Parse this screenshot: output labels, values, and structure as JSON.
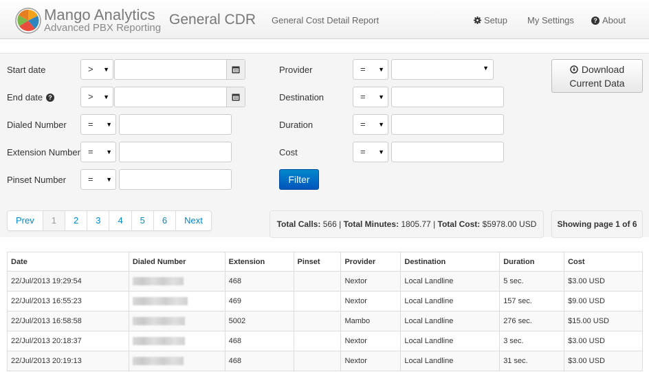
{
  "header": {
    "brand_name": "Mango Analytics",
    "brand_subtitle": "Advanced PBX Reporting",
    "title": "General CDR",
    "subtitle": "General Cost Detail Report",
    "links": {
      "setup": "Setup",
      "my_settings": "My Settings",
      "about": "About"
    }
  },
  "filters": {
    "start_date": {
      "label": "Start date",
      "operator": ">",
      "value": ""
    },
    "end_date": {
      "label": "End date",
      "operator": ">",
      "value": ""
    },
    "dialed_number": {
      "label": "Dialed Number",
      "operator": "=",
      "value": ""
    },
    "extension_number": {
      "label": "Extension Number",
      "operator": "=",
      "value": ""
    },
    "pinset_number": {
      "label": "Pinset Number",
      "operator": "=",
      "value": ""
    },
    "provider": {
      "label": "Provider",
      "operator": "=",
      "value": ""
    },
    "destination": {
      "label": "Destination",
      "operator": "=",
      "value": ""
    },
    "duration": {
      "label": "Duration",
      "operator": "=",
      "value": ""
    },
    "cost": {
      "label": "Cost",
      "operator": "=",
      "value": ""
    },
    "filter_button": "Filter",
    "download_line1": "Download",
    "download_line2": "Current Data"
  },
  "pagination": {
    "prev": "Prev",
    "pages": [
      "1",
      "2",
      "3",
      "4",
      "5",
      "6"
    ],
    "active_page": "1",
    "next": "Next"
  },
  "totals": {
    "calls_label": "Total Calls:",
    "calls": "566",
    "minutes_label": "Total Minutes:",
    "minutes": "1805.77",
    "cost_label": "Total Cost:",
    "cost": "$5978.00 USD",
    "showing": "Showing page 1 of 6"
  },
  "table": {
    "headers": [
      "Date",
      "Dialed Number",
      "Extension",
      "Pinset",
      "Provider",
      "Destination",
      "Duration",
      "Cost"
    ],
    "rows": [
      {
        "date": "22/Jul/2013 19:29:54",
        "dialed": "",
        "extension": "468",
        "pinset": "",
        "provider": "Nextor",
        "destination": "Local Landline",
        "duration": "5 sec.",
        "cost": "$3.00 USD"
      },
      {
        "date": "22/Jul/2013 16:55:23",
        "dialed": "",
        "extension": "469",
        "pinset": "",
        "provider": "Nextor",
        "destination": "Local Landline",
        "duration": "157 sec.",
        "cost": "$9.00 USD"
      },
      {
        "date": "22/Jul/2013 16:58:58",
        "dialed": "",
        "extension": "5002",
        "pinset": "",
        "provider": "Mambo",
        "destination": "Local Landline",
        "duration": "276 sec.",
        "cost": "$15.00 USD"
      },
      {
        "date": "22/Jul/2013 20:18:37",
        "dialed": "",
        "extension": "468",
        "pinset": "",
        "provider": "Nextor",
        "destination": "Local Landline",
        "duration": "3 sec.",
        "cost": "$3.00 USD"
      },
      {
        "date": "22/Jul/2013 20:19:13",
        "dialed": "",
        "extension": "468",
        "pinset": "",
        "provider": "Nextor",
        "destination": "Local Landline",
        "duration": "31 sec.",
        "cost": "$3.00 USD"
      }
    ]
  },
  "colors": {
    "accent": "#0088cc",
    "filter_button": "#0066cc",
    "panel_bg": "#f5f5f5"
  },
  "icons": {
    "logo": "pie-chart-logo",
    "setup": "gear-icon",
    "about": "question-circle-icon",
    "date_picker": "calendar-icon",
    "download": "download-circle-icon",
    "help": "question-circle-icon"
  }
}
